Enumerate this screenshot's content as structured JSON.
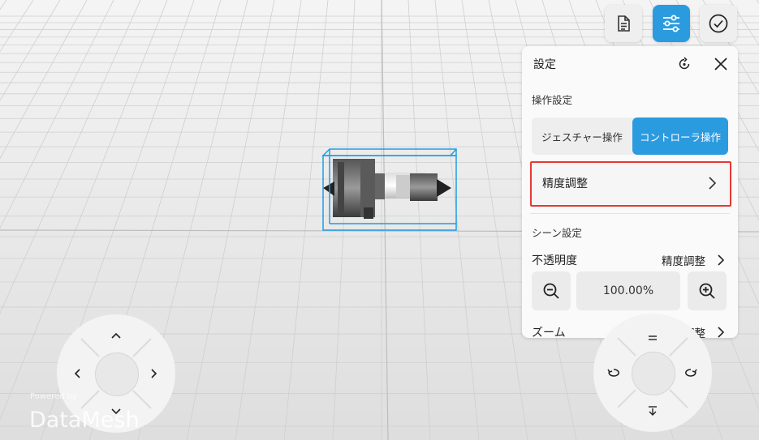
{
  "toolbar": {
    "document_icon": "document-icon",
    "settings_icon": "sliders-icon",
    "confirm_icon": "check-circle-icon",
    "active_color": "#2b9be0"
  },
  "settings_panel": {
    "title": "設定",
    "reset_icon": "reset-rotate-icon",
    "close_icon": "close-icon",
    "operation_section_label": "操作設定",
    "segments": [
      {
        "label": "ジェスチャー操作",
        "selected": false
      },
      {
        "label": "コントローラ操作",
        "selected": true
      }
    ],
    "precision_row_label": "精度調整",
    "highlight_color": "#e53935",
    "scene_section_label": "シーン設定",
    "opacity": {
      "label": "不透明度",
      "link": "精度調整",
      "value": "100.00%"
    },
    "zoom": {
      "label": "ズーム",
      "link": "精度調整"
    }
  },
  "left_pad": {
    "up": "^",
    "down": "v",
    "left": "<",
    "right": ">"
  },
  "branding": {
    "powered_by": "Powered by",
    "name": "DataMesh"
  }
}
